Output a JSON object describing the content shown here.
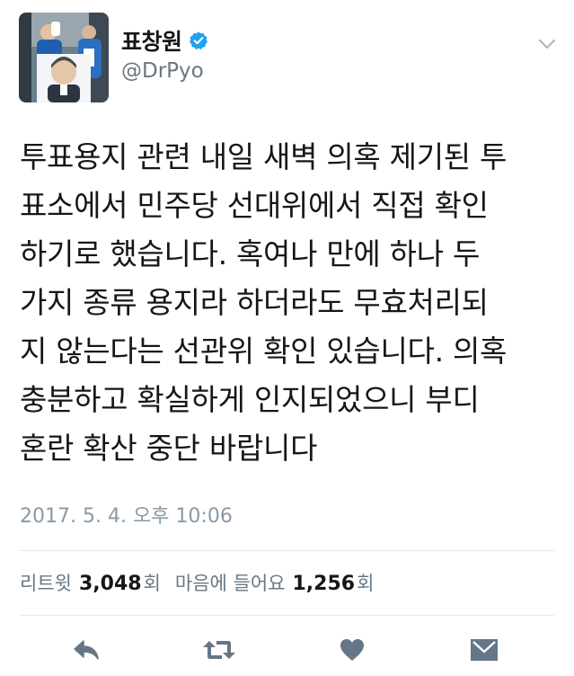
{
  "user": {
    "display_name": "표창원",
    "handle": "@DrPyo",
    "verified": true
  },
  "tweet": {
    "lines": [
      "투표용지 관련 내일 새벽 의혹 제기된 투",
      "표소에서 민주당 선대위에서 직접 확인",
      "하기로 했습니다. 혹여나 만에 하나 두",
      "가지 종류 용지라 하더라도 무효처리되",
      "지 않는다는 선관위 확인 있습니다. 의혹",
      "충분하고 확실하게 인지되었으니 부디",
      "혼란 확산 중단 바랍니다"
    ],
    "timestamp": "2017. 5. 4. 오후 10:06"
  },
  "stats": {
    "retweet_label": "리트윗",
    "retweet_count": "3,048",
    "retweet_unit": "회",
    "like_label": "마음에 들어요",
    "like_count": "1,256",
    "like_unit": "회"
  },
  "icons": {
    "verified": "verified-badge-icon",
    "menu": "chevron-down-icon",
    "reply": "reply-icon",
    "retweet": "retweet-icon",
    "like": "heart-icon",
    "message": "envelope-icon"
  },
  "colors": {
    "primary_text": "#14171a",
    "secondary_text": "#657786",
    "verified_blue": "#1da1f2",
    "action_gray": "#657786",
    "divider": "#e1e8ed"
  }
}
